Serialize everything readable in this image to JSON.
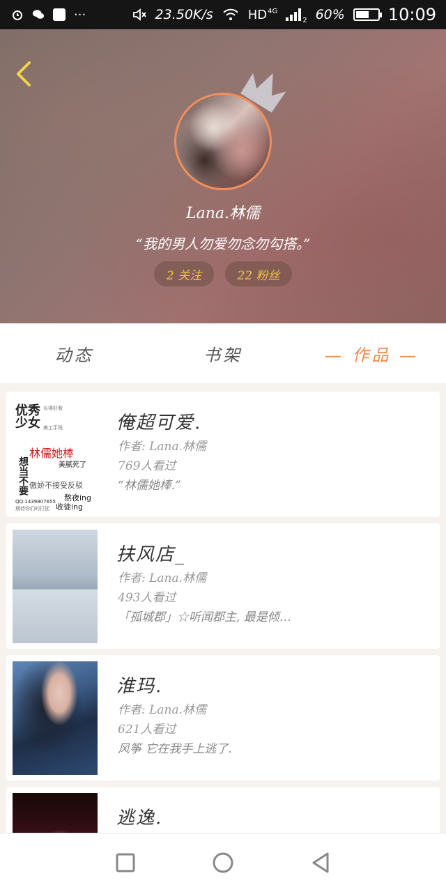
{
  "status_bar": {
    "net_speed": "23.50K/s",
    "network": "HD",
    "network_gen": "4G",
    "sim_slot": "2",
    "battery": "60%",
    "time": "10:09"
  },
  "profile": {
    "username": "Lana.林儒",
    "motto": "“我的男人勿爱勿念勿勾搭。”",
    "following": "2 关注",
    "fans": "22 粉丝"
  },
  "tabs": [
    {
      "label": "动态",
      "active": false
    },
    {
      "label": "书架",
      "active": false
    },
    {
      "label": "— 作品 —",
      "active": true
    }
  ],
  "cover_text": {
    "big1": "优秀",
    "big2": "少女",
    "red": "林儒她棒",
    "vert": "想当不要",
    "line1": "傲娇不接受反驳",
    "line2": "熬夜ing",
    "line3": "收徒ing",
    "small1": "长得好看",
    "small2": "美工手残",
    "small3": "美腻死了",
    "qq": "QQ:1439807655",
    "foot": "期待你们的打扰"
  },
  "works": [
    {
      "title": "俺超可爱.",
      "author": "作者: Lana.林儒",
      "views": "769人看过",
      "desc": "“林儒她棒.”"
    },
    {
      "title": "扶风店_",
      "author": "作者: Lana.林儒",
      "views": "493人看过",
      "desc": "「孤城郡」☆听闻郡主, 最是倾…"
    },
    {
      "title": "淮玛.",
      "author": "作者: Lana.林儒",
      "views": "621人看过",
      "desc": "风筝 它在我手上逃了."
    },
    {
      "title": "逃逸.",
      "author": "",
      "views": "",
      "desc": ""
    }
  ],
  "colors": {
    "accent": "#f08a4b",
    "stat_text": "#f3c443",
    "avatar_ring": "#f08f5c"
  }
}
